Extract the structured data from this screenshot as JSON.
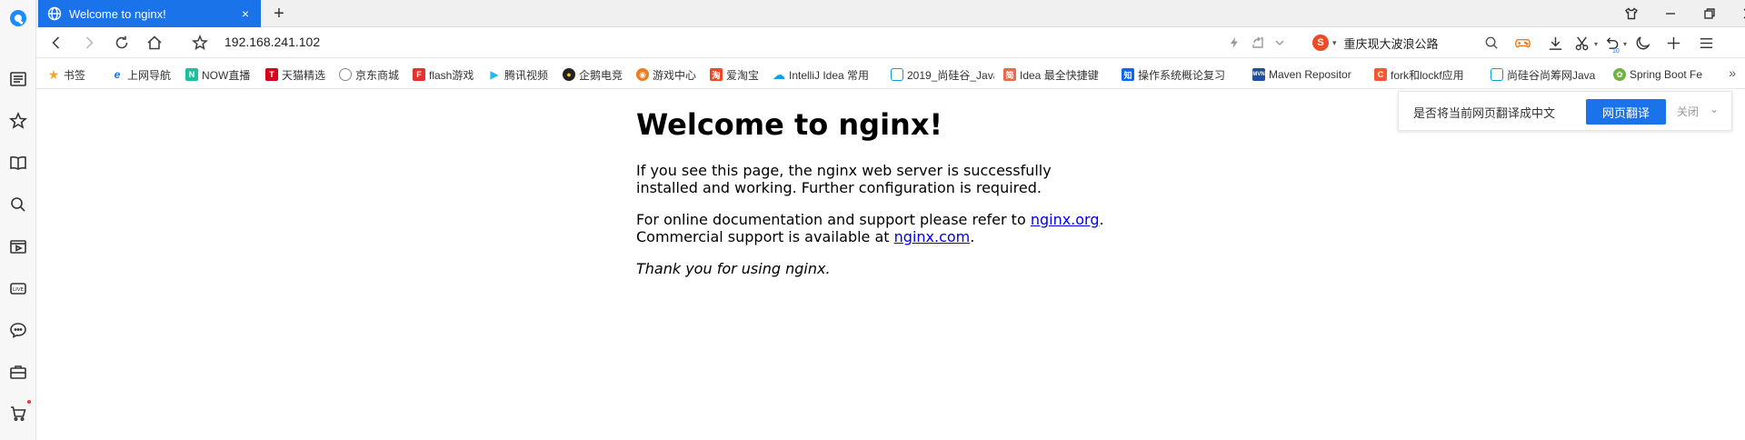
{
  "tab": {
    "title": "Welcome to nginx!",
    "close": "×",
    "new_tab": "+"
  },
  "address": {
    "url": "192.168.241.102"
  },
  "search": {
    "engine_letter": "S",
    "query": "重庆现大波浪公路"
  },
  "toolbar": {
    "history_badge": "10"
  },
  "bookmarks": [
    {
      "label": "书签",
      "icon": "star-icon",
      "color": "#f5a623"
    },
    {
      "label": "上网导航",
      "icon": "ie-icon",
      "color": "#1a73e8"
    },
    {
      "label": "NOW直播",
      "icon": "now-icon",
      "color": "#18c29c"
    },
    {
      "label": "天猫精选",
      "icon": "tmall-icon",
      "color": "#d9001b"
    },
    {
      "label": "京东商城",
      "icon": "globe-icon",
      "color": "#888888"
    },
    {
      "label": "flash游戏",
      "icon": "flash-icon",
      "color": "#e5322d"
    },
    {
      "label": "腾讯视频",
      "icon": "tencent-video-icon",
      "color": "#20b8f5"
    },
    {
      "label": "企鹅电竞",
      "icon": "penguin-icon",
      "color": "#222222"
    },
    {
      "label": "游戏中心",
      "icon": "gamepad-icon",
      "color": "#f07b1a"
    },
    {
      "label": "爱淘宝",
      "icon": "taobao-icon",
      "color": "#f04a23"
    },
    {
      "label": "IntelliJ Idea 常用",
      "icon": "cloud-icon",
      "color": "#1a9be8"
    },
    {
      "label": "2019_尚硅谷_Java",
      "icon": "bilibili-icon",
      "color": "#00a1d6"
    },
    {
      "label": "Idea 最全快捷键",
      "icon": "jian-icon",
      "color": "#e86a4c"
    },
    {
      "label": "操作系统概论复习",
      "icon": "zhihu-icon",
      "color": "#0a66ff"
    },
    {
      "label": "Maven Repositor",
      "icon": "maven-icon",
      "color": "#1f4e9c"
    },
    {
      "label": "fork和lockf应用",
      "icon": "csdn-icon",
      "color": "#fc5531"
    },
    {
      "label": "尚硅谷尚筹网Java",
      "icon": "bilibili-icon",
      "color": "#00a1d6"
    },
    {
      "label": "Spring Boot Fe",
      "icon": "spring-icon",
      "color": "#6db33f"
    }
  ],
  "bookmarks_more": "»",
  "page": {
    "heading": "Welcome to nginx!",
    "p1": "If you see this page, the nginx web server is successfully installed and working. Further configuration is required.",
    "p2_pre": "For online documentation and support please refer to ",
    "p2_link1": "nginx.org",
    "p2_mid": ".\nCommercial support is available at ",
    "p2_link2": "nginx.com",
    "p2_post": ".",
    "p3": "Thank you for using nginx."
  },
  "translate": {
    "question": "是否将当前网页翻译成中文",
    "button": "网页翻译",
    "close": "关闭",
    "chevron": "⌄"
  }
}
